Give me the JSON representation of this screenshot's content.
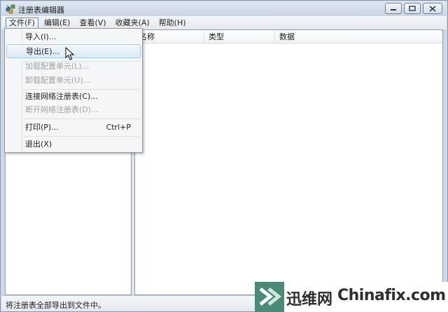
{
  "window": {
    "title": "注册表编辑器"
  },
  "menubar": [
    {
      "label": "文件(F)",
      "active": true
    },
    {
      "label": "编辑(E)"
    },
    {
      "label": "查看(V)"
    },
    {
      "label": "收藏夹(A)"
    },
    {
      "label": "帮助(H)"
    }
  ],
  "list_columns": [
    "名称",
    "类型",
    "数据"
  ],
  "file_menu": {
    "items": [
      {
        "label": "导入(I)...",
        "state": "enabled"
      },
      {
        "label": "导出(E)...",
        "state": "hover"
      },
      {
        "label": "加载配置单元(L)...",
        "state": "disabled"
      },
      {
        "label": "卸载配置单元(U)...",
        "state": "disabled"
      },
      {
        "label": "连接网络注册表(C)...",
        "state": "enabled"
      },
      {
        "label": "断开网络注册表(D)...",
        "state": "disabled"
      },
      {
        "label": "打印(P)...",
        "state": "enabled",
        "shortcut": "Ctrl+P"
      },
      {
        "label": "退出(X)",
        "state": "enabled"
      }
    ]
  },
  "statusbar": {
    "text": "将注册表全部导出到文件中。"
  },
  "watermark": {
    "brand_cn": "迅维网",
    "brand_en": "Chinafix.com"
  },
  "icons": {
    "app": "regedit-icon",
    "minimize": "minimize-icon",
    "maximize": "maximize-icon",
    "close": "close-icon",
    "cursor": "mouse-pointer-icon",
    "watermark_logo": "chinafix-logo-icon"
  },
  "colors": {
    "menu_hover_border": "#a8cbe9",
    "title_bar": "#c9d6e4",
    "watermark_green": "#4b8a76"
  }
}
